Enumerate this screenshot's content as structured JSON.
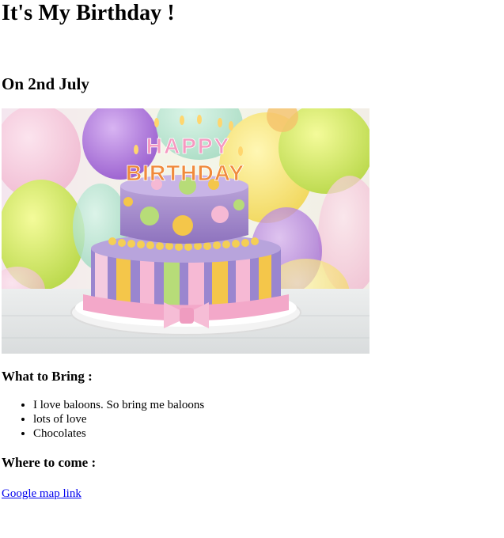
{
  "page": {
    "title": "It's My Birthday !",
    "date_heading": "On 2nd July"
  },
  "photo": {
    "topper_line1": "HAPPY",
    "topper_line2": "BIRTHDAY"
  },
  "bring": {
    "heading": "What to Bring :",
    "items": [
      "I love baloons. So bring me baloons",
      "lots of love",
      "Chocolates"
    ]
  },
  "where": {
    "heading": "Where to come :",
    "link_label": "Google map link"
  },
  "colors": {
    "link": "#0000ee",
    "text": "#000000",
    "background": "#ffffff"
  }
}
